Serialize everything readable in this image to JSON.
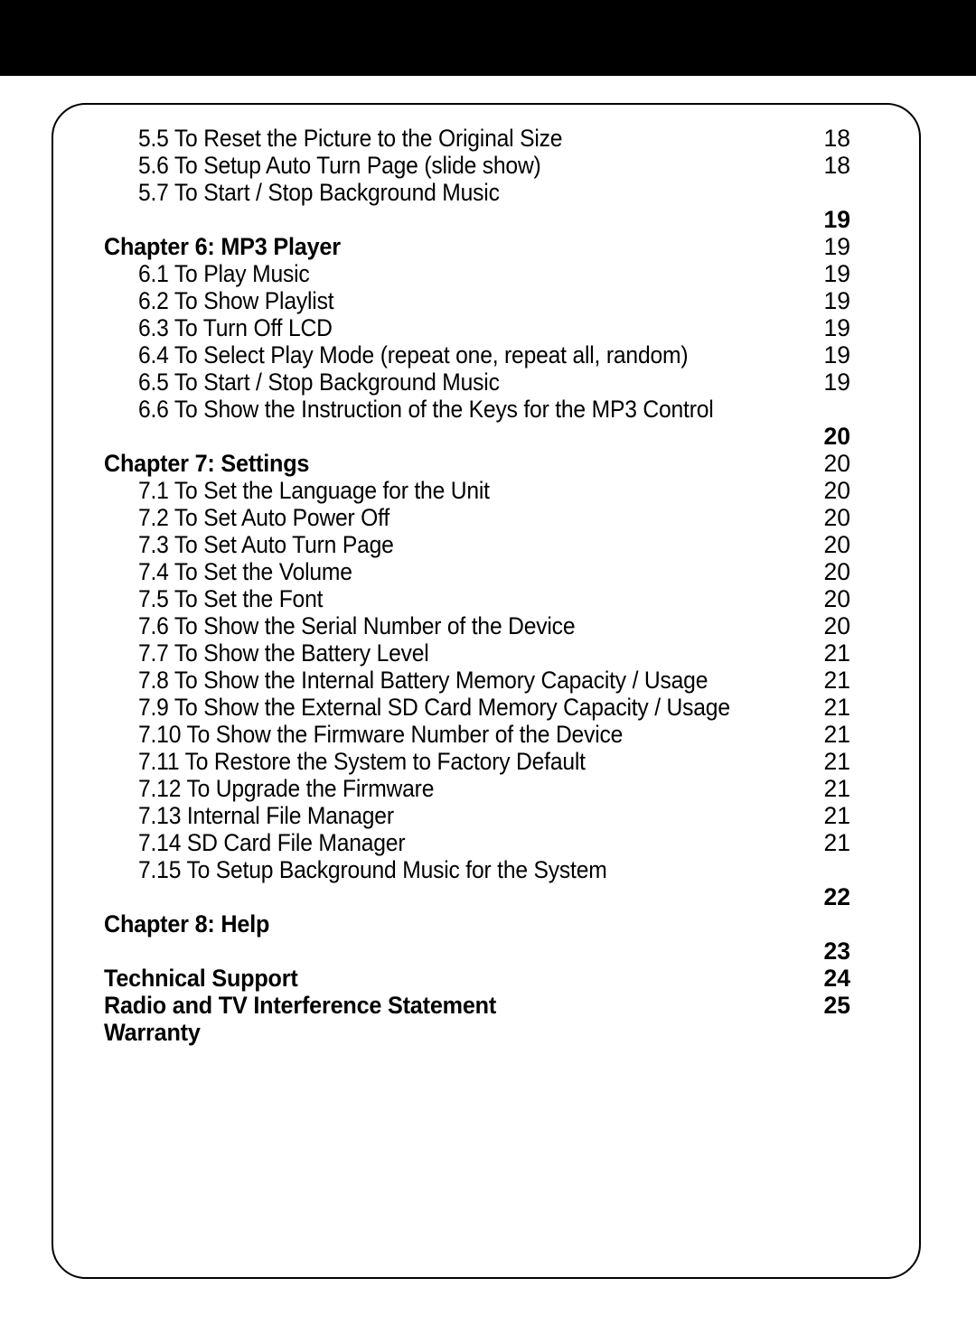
{
  "document": {
    "type": "table-of-contents",
    "entries": [
      {
        "kind": "sub",
        "text": "5.5 To Reset the Picture to the Original Size",
        "page": "18",
        "page_bold": false
      },
      {
        "kind": "sub",
        "text": "5.6 To Setup Auto Turn Page (slide show)",
        "page": "18",
        "page_bold": false
      },
      {
        "kind": "sub",
        "text": "5.7 To Start / Stop Background Music",
        "page": "",
        "page_bold": false
      },
      {
        "kind": "page-only",
        "text": "",
        "page": "19",
        "page_bold": true
      },
      {
        "kind": "chapter",
        "text": "Chapter 6: MP3 Player",
        "page": "19",
        "page_bold": false
      },
      {
        "kind": "sub",
        "text": "6.1 To Play Music",
        "page": "19",
        "page_bold": false
      },
      {
        "kind": "sub",
        "text": "6.2 To Show Playlist",
        "page": "19",
        "page_bold": false
      },
      {
        "kind": "sub",
        "text": "6.3 To Turn Off LCD",
        "page": "19",
        "page_bold": false
      },
      {
        "kind": "sub",
        "text": "6.4 To Select Play Mode (repeat one, repeat all, random)",
        "page": "19",
        "page_bold": false
      },
      {
        "kind": "sub",
        "text": "6.5 To Start / Stop Background Music",
        "page": "19",
        "page_bold": false
      },
      {
        "kind": "sub",
        "text": "6.6 To Show the Instruction of the Keys for the MP3 Control",
        "page": "",
        "page_bold": false
      },
      {
        "kind": "page-only",
        "text": "",
        "page": "20",
        "page_bold": true
      },
      {
        "kind": "chapter",
        "text": "Chapter 7: Settings",
        "page": "20",
        "page_bold": false
      },
      {
        "kind": "sub",
        "text": "7.1 To Set the Language for the Unit",
        "page": "20",
        "page_bold": false
      },
      {
        "kind": "sub",
        "text": "7.2 To Set Auto Power Off",
        "page": "20",
        "page_bold": false
      },
      {
        "kind": "sub",
        "text": "7.3 To Set Auto Turn Page",
        "page": "20",
        "page_bold": false
      },
      {
        "kind": "sub",
        "text": "7.4 To Set the Volume",
        "page": "20",
        "page_bold": false
      },
      {
        "kind": "sub",
        "text": "7.5 To Set the Font",
        "page": "20",
        "page_bold": false
      },
      {
        "kind": "sub",
        "text": "7.6 To Show the Serial Number of the Device",
        "page": "20",
        "page_bold": false
      },
      {
        "kind": "sub",
        "text": "7.7 To Show the Battery Level",
        "page": "21",
        "page_bold": false
      },
      {
        "kind": "sub",
        "text": "7.8 To Show the Internal Battery Memory Capacity / Usage",
        "page": "21",
        "page_bold": false
      },
      {
        "kind": "sub",
        "text": "7.9 To Show the External SD Card Memory Capacity / Usage",
        "page": "21",
        "page_bold": false
      },
      {
        "kind": "sub",
        "text": "7.10 To Show the Firmware Number of the Device",
        "page": "21",
        "page_bold": false
      },
      {
        "kind": "sub",
        "text": "7.11 To Restore the System to Factory Default",
        "page": "21",
        "page_bold": false
      },
      {
        "kind": "sub",
        "text": "7.12 To Upgrade the Firmware",
        "page": "21",
        "page_bold": false
      },
      {
        "kind": "sub",
        "text": "7.13 Internal File Manager",
        "page": "21",
        "page_bold": false
      },
      {
        "kind": "sub",
        "text": "7.14 SD Card File Manager",
        "page": "21",
        "page_bold": false
      },
      {
        "kind": "sub",
        "text": "7.15 To Setup Background Music for the System",
        "page": "",
        "page_bold": false
      },
      {
        "kind": "page-only",
        "text": "",
        "page": "22",
        "page_bold": true
      },
      {
        "kind": "chapter",
        "text": "Chapter 8: Help",
        "page": "",
        "page_bold": false
      },
      {
        "kind": "page-only",
        "text": "",
        "page": "23",
        "page_bold": true
      },
      {
        "kind": "chapter",
        "text": "Technical Support",
        "page": "24",
        "page_bold": true
      },
      {
        "kind": "chapter",
        "text": "Radio and TV Interference Statement",
        "page": "25",
        "page_bold": true
      },
      {
        "kind": "chapter",
        "text": "Warranty",
        "page": "",
        "page_bold": false
      }
    ]
  }
}
